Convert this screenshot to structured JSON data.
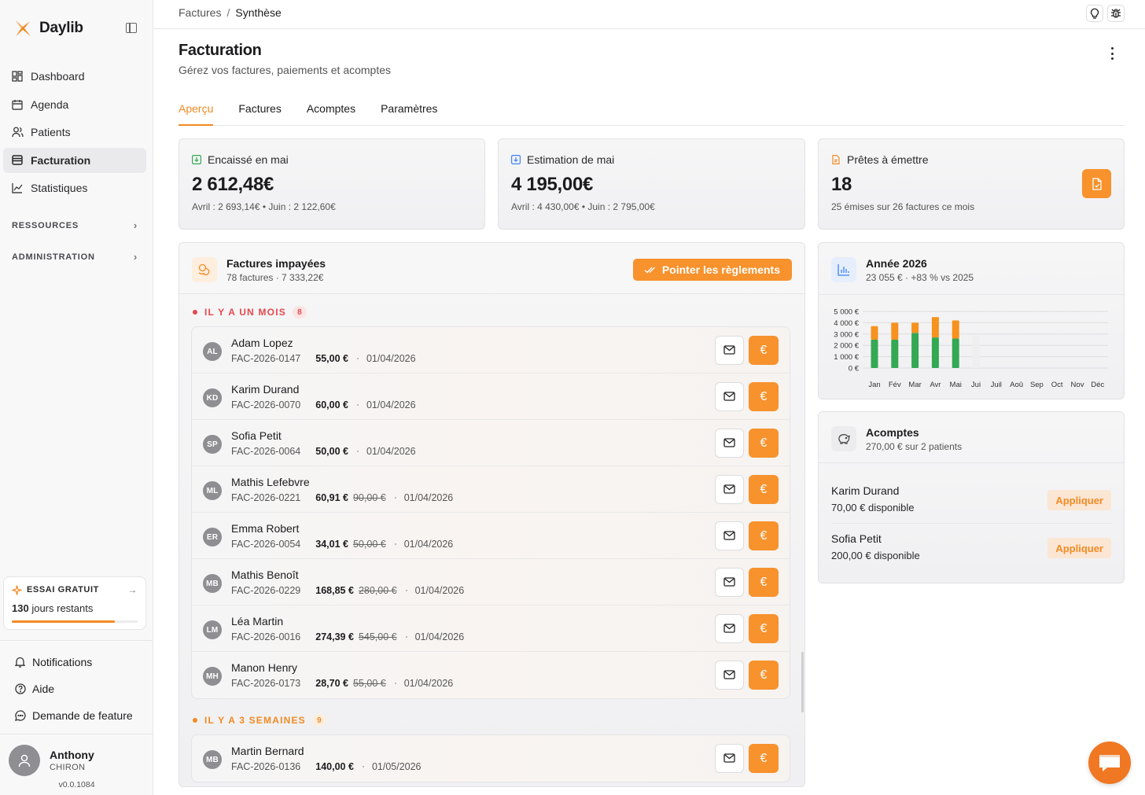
{
  "app": {
    "name": "Daylib"
  },
  "sidebar": {
    "nav": [
      {
        "label": "Dashboard",
        "icon": "grid-icon"
      },
      {
        "label": "Agenda",
        "icon": "calendar-icon"
      },
      {
        "label": "Patients",
        "icon": "users-icon"
      },
      {
        "label": "Facturation",
        "icon": "invoice-icon",
        "active": true
      },
      {
        "label": "Statistiques",
        "icon": "chart-line-icon"
      }
    ],
    "sections": [
      "RESSOURCES",
      "ADMINISTRATION"
    ],
    "trial": {
      "title": "ESSAI GRATUIT",
      "days": "130",
      "days_suffix": "jours restants",
      "progress": 0.82
    },
    "links": [
      {
        "label": "Notifications",
        "icon": "bell-icon"
      },
      {
        "label": "Aide",
        "icon": "help-icon"
      },
      {
        "label": "Demande de feature",
        "icon": "chat-icon"
      }
    ],
    "user": {
      "first_name": "Anthony",
      "last_name": "CHIRON",
      "version": "v0.0.1084"
    }
  },
  "breadcrumb": {
    "parent": "Factures",
    "separator": "/",
    "current": "Synthèse"
  },
  "header": {
    "title": "Facturation",
    "subtitle": "Gérez vos factures, paiements et acomptes"
  },
  "tabs": [
    "Aperçu",
    "Factures",
    "Acomptes",
    "Paramètres"
  ],
  "stats": [
    {
      "title": "Encaissé en mai",
      "value": "2 612,48€",
      "sub": "Avril : 2 693,14€ • Juin : 2 122,60€",
      "icon_color": "#34a853"
    },
    {
      "title": "Estimation de mai",
      "value": "4 195,00€",
      "sub": "Avril : 4 430,00€ • Juin : 2 795,00€",
      "icon_color": "#3b82f6"
    },
    {
      "title": "Prêtes à émettre",
      "value": "18",
      "sub": "25 émises sur 26 factures ce mois",
      "icon_color": "#f28a24"
    }
  ],
  "unpaid": {
    "title": "Factures impayées",
    "subtitle": "78 factures · 7 333,22€",
    "action": "Pointer les règlements",
    "groups": [
      {
        "label": "IL Y A UN MOIS",
        "count": "8",
        "color": "#e5484d",
        "badge_bg": "#fde4e4",
        "rows": [
          {
            "initials": "AL",
            "name": "Adam Lopez",
            "ref": "FAC-2026-0147",
            "amount": "55,00 €",
            "old": "",
            "date": "01/04/2026"
          },
          {
            "initials": "KD",
            "name": "Karim Durand",
            "ref": "FAC-2026-0070",
            "amount": "60,00 €",
            "old": "",
            "date": "01/04/2026"
          },
          {
            "initials": "SP",
            "name": "Sofia Petit",
            "ref": "FAC-2026-0064",
            "amount": "50,00 €",
            "old": "",
            "date": "01/04/2026"
          },
          {
            "initials": "ML",
            "name": "Mathis Lefebvre",
            "ref": "FAC-2026-0221",
            "amount": "60,91 €",
            "old": "90,00 €",
            "date": "01/04/2026"
          },
          {
            "initials": "ER",
            "name": "Emma Robert",
            "ref": "FAC-2026-0054",
            "amount": "34,01 €",
            "old": "50,00 €",
            "date": "01/04/2026"
          },
          {
            "initials": "MB",
            "name": "Mathis Benoît",
            "ref": "FAC-2026-0229",
            "amount": "168,85 €",
            "old": "280,00 €",
            "date": "01/04/2026"
          },
          {
            "initials": "LM",
            "name": "Léa Martin",
            "ref": "FAC-2026-0016",
            "amount": "274,39 €",
            "old": "545,00 €",
            "date": "01/04/2026"
          },
          {
            "initials": "MH",
            "name": "Manon Henry",
            "ref": "FAC-2026-0173",
            "amount": "28,70 €",
            "old": "55,00 €",
            "date": "01/04/2026"
          }
        ]
      },
      {
        "label": "IL Y A 3 SEMAINES",
        "count": "9",
        "color": "#f28a24",
        "badge_bg": "#fdeede",
        "rows": [
          {
            "initials": "MB",
            "name": "Martin Bernard",
            "ref": "FAC-2026-0136",
            "amount": "140,00 €",
            "old": "",
            "date": "01/05/2026"
          }
        ]
      }
    ]
  },
  "year_card": {
    "title": "Année 2026",
    "subtitle": "23 055 € · +83 % vs 2025"
  },
  "chart_data": {
    "type": "bar",
    "stacked": true,
    "categories": [
      "Jan",
      "Fév",
      "Mar",
      "Avr",
      "Mai",
      "Jui",
      "Juil",
      "Aoû",
      "Sep",
      "Oct",
      "Nov",
      "Déc"
    ],
    "series": [
      {
        "color": "#34a853",
        "values": [
          2500,
          2500,
          3100,
          2700,
          2600,
          0,
          0,
          0,
          0,
          0,
          0,
          0
        ]
      },
      {
        "color": "#f7921e",
        "values": [
          1200,
          1500,
          900,
          1800,
          1600,
          0,
          0,
          0,
          0,
          0,
          0,
          0
        ]
      },
      {
        "color": "#eeeeef",
        "values": [
          0,
          0,
          0,
          0,
          0,
          2800,
          0,
          0,
          0,
          0,
          0,
          0
        ]
      }
    ],
    "yticks": [
      "5 000 €",
      "4 000 €",
      "3 000 €",
      "2 000 €",
      "1 000 €",
      "0 €"
    ],
    "ylim": [
      0,
      5000
    ],
    "grid": true
  },
  "deposits": {
    "title": "Acomptes",
    "subtitle": "270,00 € sur 2 patients",
    "apply_label": "Appliquer",
    "items": [
      {
        "name": "Karim Durand",
        "available": "70,00 € disponible"
      },
      {
        "name": "Sofia Petit",
        "available": "200,00 € disponible"
      }
    ]
  },
  "colors": {
    "accent": "#f7922d",
    "accent_text": "#f28a24"
  }
}
